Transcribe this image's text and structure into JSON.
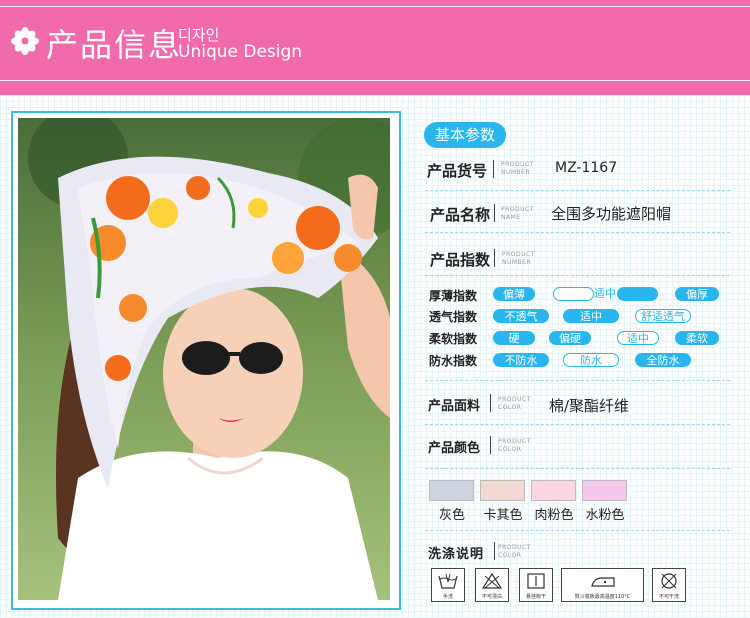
{
  "header": {
    "title_cn": "产品信息",
    "title_kr": "디자인",
    "title_en": "Unique Design",
    "icon": "flower-icon"
  },
  "photo": {
    "alt": "model-photo"
  },
  "params": {
    "badge": "基本参数",
    "sub_text": "PRODUCT",
    "rows": [
      {
        "label": "产品货号",
        "sub1": "PRODUCT",
        "sub2": "NUMBER",
        "value": "MZ-1167"
      },
      {
        "label": "产品名称",
        "sub1": "PRODUCT",
        "sub2": "NAME",
        "value": "全围多功能遮阳帽"
      },
      {
        "label": "产品指数",
        "sub1": "PRODUCT",
        "sub2": "NUMBER",
        "value": ""
      }
    ],
    "indices": [
      {
        "label": "厚薄指数",
        "options": [
          "偏薄",
          "",
          "适中",
          "",
          "偏厚"
        ]
      },
      {
        "label": "透气指数",
        "options": [
          "不透气",
          "适中",
          "舒适透气"
        ]
      },
      {
        "label": "柔软指数",
        "options": [
          "硬",
          "偏硬",
          "适中",
          "柔软"
        ]
      },
      {
        "label": "防水指数",
        "options": [
          "不防水",
          "防水",
          "全防水"
        ]
      }
    ],
    "fabric": {
      "label": "产品面料",
      "sub1": "PRODUCT",
      "sub2": "COLOR",
      "value": "棉/聚酯纤维"
    },
    "colors": {
      "label": "产品颜色",
      "sub1": "PRODUCT",
      "sub2": "COLOR",
      "items": [
        {
          "name": "灰色",
          "hex": "#cfd5e0"
        },
        {
          "name": "卡其色",
          "hex": "#f2d9d2"
        },
        {
          "name": "肉粉色",
          "hex": "#fbd6e2"
        },
        {
          "name": "水粉色",
          "hex": "#f6c8ec"
        }
      ]
    },
    "care": {
      "label": "洗涤说明",
      "sub1": "PRODUCT",
      "sub2": "COLOR",
      "items": [
        {
          "icon": "hand-wash-icon",
          "caption": "手洗"
        },
        {
          "icon": "no-bleach-icon",
          "caption": "不可漂白"
        },
        {
          "icon": "hang-dry-icon",
          "caption": "悬挂晾干"
        },
        {
          "icon": "iron-icon",
          "caption": "熨斗底板最高温度110°C"
        },
        {
          "icon": "no-tumble-dry-icon",
          "caption": "不可干洗"
        }
      ]
    }
  },
  "colors": {
    "accent": "#29b6ee",
    "banner": "#f06aac",
    "frame": "#3dbbe8"
  }
}
